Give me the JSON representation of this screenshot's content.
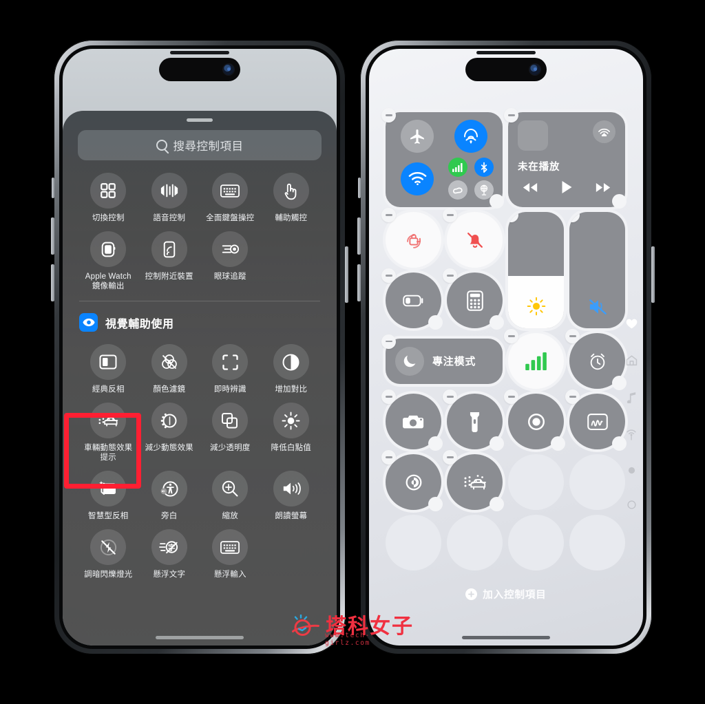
{
  "left_phone": {
    "panel_name": "control-gallery-sheet",
    "search": {
      "placeholder": "搜尋控制項目",
      "icon": "search-icon"
    },
    "accessibility_section": {
      "items": [
        {
          "label": "切換控制",
          "icon": "switch-control-icon"
        },
        {
          "label": "語音控制",
          "icon": "voice-control-icon"
        },
        {
          "label": "全面鍵盤操控",
          "icon": "full-keyboard-access-icon"
        },
        {
          "label": "輔助觸控",
          "icon": "assistive-touch-icon"
        },
        {
          "label": "Apple Watch\n鏡像輸出",
          "icon": "apple-watch-mirroring-icon"
        },
        {
          "label": "控制附近裝置",
          "icon": "control-nearby-devices-icon"
        },
        {
          "label": "眼球追蹤",
          "icon": "eye-tracking-icon"
        }
      ]
    },
    "vision_section": {
      "header": "視覺輔助使用",
      "header_icon": "eye-icon",
      "header_badge_color": "#0a84ff",
      "items": [
        {
          "label": "經典反相",
          "icon": "classic-invert-icon"
        },
        {
          "label": "顏色濾鏡",
          "icon": "color-filters-icon"
        },
        {
          "label": "即時辨識",
          "icon": "live-recognition-icon"
        },
        {
          "label": "增加對比",
          "icon": "increase-contrast-icon"
        },
        {
          "label": "車輛動態效果\n提示",
          "icon": "vehicle-motion-cues-icon",
          "highlighted": true
        },
        {
          "label": "減少動態效果",
          "icon": "reduce-motion-icon"
        },
        {
          "label": "減少透明度",
          "icon": "reduce-transparency-icon"
        },
        {
          "label": "降低白點值",
          "icon": "reduce-white-point-icon"
        },
        {
          "label": "智慧型反相",
          "icon": "smart-invert-icon"
        },
        {
          "label": "旁白",
          "icon": "voiceover-icon"
        },
        {
          "label": "縮放",
          "icon": "zoom-icon"
        },
        {
          "label": "朗讀螢幕",
          "icon": "speak-screen-icon"
        },
        {
          "label": "調暗閃爍燈光",
          "icon": "dim-flashing-lights-icon"
        },
        {
          "label": "懸浮文字",
          "icon": "hover-text-icon"
        },
        {
          "label": "懸浮輸入",
          "icon": "hover-typing-icon"
        }
      ]
    },
    "highlight_color": "#ff1f32"
  },
  "right_phone": {
    "panel_name": "control-center-edit-mode",
    "connectivity": {
      "airplane_mode": {
        "icon": "airplane-icon",
        "active": false
      },
      "airdrop": {
        "icon": "airdrop-icon",
        "active": true,
        "color": "#0a84ff"
      },
      "wifi": {
        "icon": "wifi-icon",
        "active": true,
        "color": "#0a84ff"
      },
      "cellular": {
        "icon": "cellular-bars-icon",
        "active": true,
        "color": "#30c94f"
      },
      "bluetooth": {
        "icon": "bluetooth-icon",
        "active": true,
        "color": "#0a84ff"
      },
      "personal_hotspot": {
        "icon": "personal-hotspot-icon",
        "active": false
      },
      "satellite": {
        "icon": "satellite-icon",
        "active": false
      }
    },
    "now_playing": {
      "title": "未在播放",
      "airplay_icon": "airplay-icon",
      "artwork": "album-art-placeholder",
      "controls": [
        "rewind-icon",
        "play-icon",
        "fast-forward-icon"
      ]
    },
    "tiles": [
      {
        "label": "",
        "icon": "rotation-lock-icon",
        "style": "light",
        "accent": "#f07070"
      },
      {
        "label": "",
        "icon": "silent-mode-icon",
        "style": "light",
        "accent": "#f05050"
      },
      {
        "label": "",
        "icon": "low-power-mode-icon",
        "style": "dark"
      },
      {
        "label": "",
        "icon": "calculator-icon",
        "style": "dark"
      },
      {
        "label": "專注模式",
        "icon": "focus-moon-icon",
        "style": "dark",
        "wide": true
      },
      {
        "label": "",
        "icon": "cellular-bars-icon",
        "style": "light",
        "accent": "#30c94f"
      },
      {
        "label": "",
        "icon": "alarm-clock-icon",
        "style": "dark"
      },
      {
        "label": "",
        "icon": "camera-icon",
        "style": "dark"
      },
      {
        "label": "",
        "icon": "flashlight-icon",
        "style": "dark"
      },
      {
        "label": "",
        "icon": "screen-record-icon",
        "style": "dark"
      },
      {
        "label": "",
        "icon": "notes-icon",
        "style": "dark"
      },
      {
        "label": "",
        "icon": "dark-mode-icon",
        "style": "dark"
      },
      {
        "label": "",
        "icon": "vehicle-motion-cues-icon",
        "style": "dark"
      }
    ],
    "brightness_slider": {
      "icon": "brightness-sun-icon",
      "value_percent": 45
    },
    "volume_slider": {
      "icon": "volume-mute-icon",
      "value_percent": 0,
      "accent": "#3b9dfb"
    },
    "page_indicators": [
      {
        "icon": "heart-icon",
        "active": true
      },
      {
        "icon": "home-icon",
        "active": false
      },
      {
        "icon": "music-note-icon",
        "active": false
      },
      {
        "icon": "connectivity-icon",
        "active": false
      },
      {
        "icon": "dot-filled-icon",
        "active": false
      },
      {
        "icon": "dot-outline-icon",
        "active": false
      }
    ],
    "add_control": {
      "label": "加入控制項目",
      "icon": "plus-icon"
    }
  },
  "watermark": {
    "brand": "塔科女子",
    "url": "www.tech-girlz.com"
  }
}
